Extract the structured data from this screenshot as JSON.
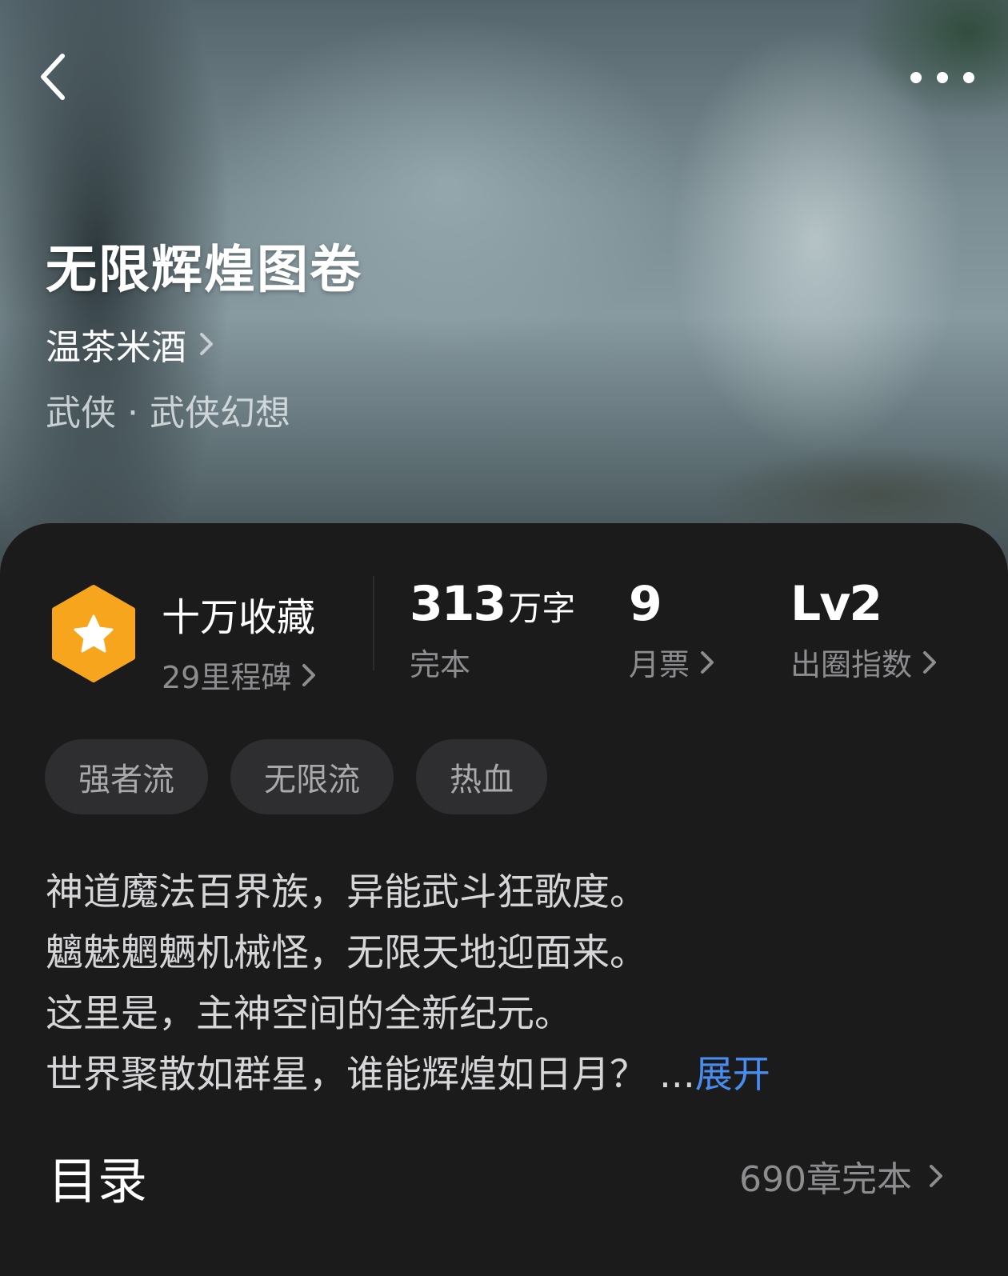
{
  "book": {
    "title": "无限辉煌图卷",
    "author": "温茶米酒",
    "genre": "武侠 · 武侠幻想"
  },
  "stats": {
    "collection_title": "十万收藏",
    "milestone": "29里程碑",
    "word_count": "313",
    "word_unit": "万字",
    "status": "完本",
    "monthly_votes": "9",
    "monthly_votes_label": "月票",
    "circle_index": "Lv2",
    "circle_index_label": "出圈指数"
  },
  "tags": [
    "强者流",
    "无限流",
    "热血"
  ],
  "description": {
    "lines": [
      "神道魔法百界族，异能武斗狂歌度。",
      "魑魅魍魉机械怪，无限天地迎面来。",
      "这里是，主神空间的全新纪元。",
      "世界聚散如群星，谁能辉煌如日月？"
    ],
    "ellipsis": "...",
    "expand_label": "展开"
  },
  "toc": {
    "label": "目录",
    "chapters": "690章完本"
  },
  "colors": {
    "accent_link": "#4a8df0",
    "badge": "#f7a51c"
  },
  "icons": [
    "back-arrow-icon",
    "more-dots-icon",
    "chevron-right-icon",
    "star-badge-icon"
  ]
}
